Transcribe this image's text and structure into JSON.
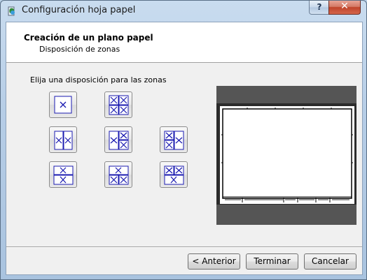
{
  "window": {
    "title": "Configuración hoja papel",
    "help_label": "?",
    "close_label": "✕"
  },
  "header": {
    "title": "Creación de un plano papel",
    "subtitle": "Disposición de zonas"
  },
  "main": {
    "prompt": "Elija una disposición para las zonas",
    "layouts": [
      "single-zone",
      "four-zones-grid",
      "two-zones-vertical",
      "one-left-two-right",
      "two-left-one-right",
      "two-zones-horizontal",
      "one-top-two-bottom",
      "two-top-one-bottom"
    ]
  },
  "footer": {
    "back_label": "< Anterior",
    "finish_label": "Terminar",
    "cancel_label": "Cancelar"
  },
  "colors": {
    "zone_color": "#1a1ab0",
    "preview_bg": "#555555"
  }
}
